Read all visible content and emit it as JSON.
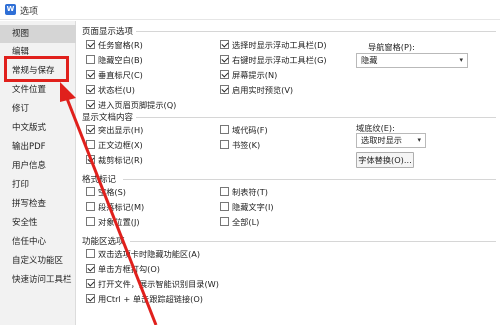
{
  "window": {
    "title": "选项",
    "icon_letter": "W"
  },
  "sidebar": {
    "items": [
      {
        "label": "视图"
      },
      {
        "label": "编辑"
      },
      {
        "label": "常规与保存"
      },
      {
        "label": "文件位置"
      },
      {
        "label": "修订"
      },
      {
        "label": "中文版式"
      },
      {
        "label": "输出PDF"
      },
      {
        "label": "用户信息"
      },
      {
        "label": "打印"
      },
      {
        "label": "拼写检查"
      },
      {
        "label": "安全性"
      },
      {
        "label": "信任中心"
      },
      {
        "label": "自定义功能区"
      },
      {
        "label": "快速访问工具栏"
      }
    ],
    "active_index": 0,
    "highlighted_index": 2
  },
  "page_display": {
    "title": "页面显示选项",
    "col1": [
      {
        "label": "任务窗格(R)",
        "checked": true
      },
      {
        "label": "隐藏空白(B)",
        "checked": false
      },
      {
        "label": "垂直标尺(C)",
        "checked": true
      },
      {
        "label": "状态栏(U)",
        "checked": true
      },
      {
        "label": "进入页眉页脚提示(Q)",
        "checked": true
      }
    ],
    "col2": [
      {
        "label": "选择时显示浮动工具栏(D)",
        "checked": true
      },
      {
        "label": "右键时显示浮动工具栏(G)",
        "checked": true
      },
      {
        "label": "屏幕提示(N)",
        "checked": true
      },
      {
        "label": "启用实时预览(V)",
        "checked": true
      }
    ],
    "nav_pane_label": "导航窗格(P):",
    "nav_pane_value": "隐藏"
  },
  "doc_content": {
    "title": "显示文档内容",
    "col1": [
      {
        "label": "突出显示(H)",
        "checked": true
      },
      {
        "label": "正文边框(X)",
        "checked": false
      },
      {
        "label": "裁剪标记(R)",
        "checked": true
      }
    ],
    "col2": [
      {
        "label": "域代码(F)",
        "checked": false
      },
      {
        "label": "书签(K)",
        "checked": false
      }
    ],
    "field_shading_label": "域底纹(E):",
    "field_shading_value": "选取时显示",
    "font_replace_button": "字体替换(O)..."
  },
  "format_marks": {
    "title": "格式标记",
    "col1": [
      {
        "label": "空格(S)",
        "checked": false
      },
      {
        "label": "段落标记(M)",
        "checked": false
      },
      {
        "label": "对象位置(J)",
        "checked": false
      }
    ],
    "col2": [
      {
        "label": "制表符(T)",
        "checked": false
      },
      {
        "label": "隐藏文字(I)",
        "checked": false
      },
      {
        "label": "全部(L)",
        "checked": false
      }
    ]
  },
  "ribbon_options": {
    "title": "功能区选项",
    "items": [
      {
        "label": "双击选项卡时隐藏功能区(A)",
        "checked": false
      },
      {
        "label": "单击方框打勾(O)",
        "checked": true
      },
      {
        "label": "打开文件，展示智能识别目录(W)",
        "checked": true
      },
      {
        "label": "用Ctrl + 单击跟踪超链接(O)",
        "checked": true
      }
    ]
  },
  "annotation": {
    "highlight_color": "#e0201c",
    "arrow_color": "#e0201c"
  }
}
